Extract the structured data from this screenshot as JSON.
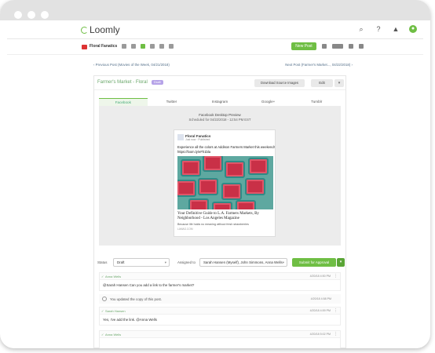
{
  "topnav": {
    "logo": "Loomly",
    "icons": [
      "search-icon",
      "help-icon",
      "bell-icon",
      "user-avatar"
    ]
  },
  "subnav": {
    "calendar_name": "Floral Fanatics",
    "new_post_label": "New Post"
  },
  "post_nav": {
    "prev_label": "‹  Previous Post (Movies of the Week, 04/21/2018)",
    "next_label": "Next Post (Farmer's Market..., 04/22/2018)  ›"
  },
  "post": {
    "title": "Farmer's Market - Floral",
    "badge": "Draft",
    "download_label": "Download Source Images",
    "edit_label": "Edit",
    "tabs": [
      "Facebook",
      "Twitter",
      "Instagram",
      "Google+",
      "Tumblr"
    ],
    "active_tab": "Facebook"
  },
  "preview": {
    "title": "Facebook Desktop Preview",
    "scheduled": "Scheduled for 04/22/2018 - 12:54 PM EST",
    "page_name": "Floral Fanatics",
    "page_sub": "Just now · Published",
    "text": "Experience all the colors at Addison Farmers Market this weekend! https://loom.ly/eFh1bla",
    "link_title": "Your Definitive Guide to L.A. Farmers Markets, By Neighborhood - Los Angeles Magazine",
    "link_desc": "Because life holds no meaning without fresh strawberries",
    "link_domain": "LAMAG.COM"
  },
  "workflow": {
    "status_label": "Status",
    "status_value": "Draft",
    "assigned_label": "Assigned to",
    "assigned_value": "Sarah Hansen (Myself), John Simmons, Anna Wells",
    "submit_label": "Submit for Approval"
  },
  "comments": [
    {
      "author": "Anna Wells",
      "date": "4/20/18 4:50 PM",
      "body": "@Sarah Hansen Can you add a link to the farmer's market?"
    },
    {
      "system": "You updated the copy of this post.",
      "date": "4/20/18 4:58 PM"
    },
    {
      "author": "Sarah Hansen",
      "date": "4/20/18 4:59 PM",
      "body": "Yes, I've add the link. @Anna Wells"
    },
    {
      "author": "Anna Wells",
      "date": "4/20/18 5:02 PM",
      "body": ""
    }
  ]
}
